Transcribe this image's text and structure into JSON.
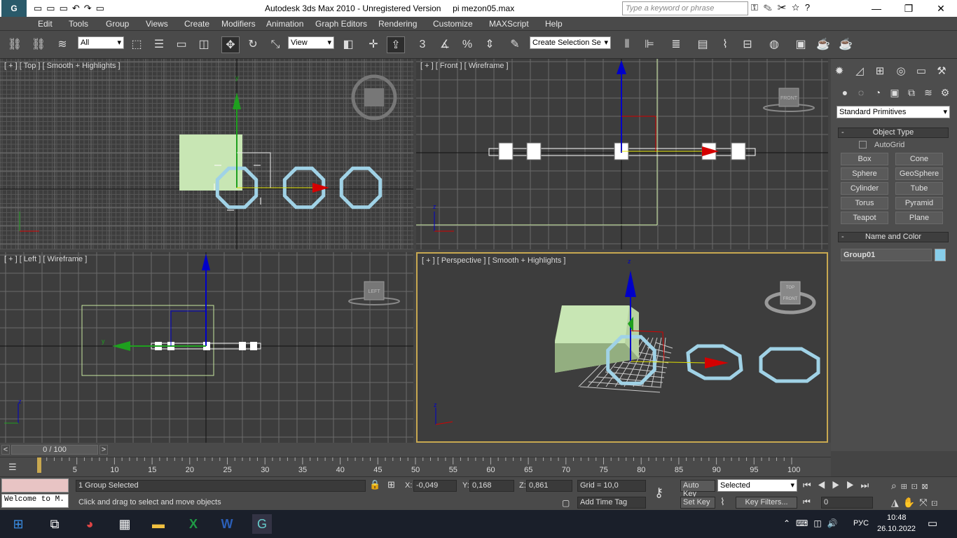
{
  "titlebar": {
    "app": "Autodesk 3ds Max  2010  - Unregistered Version",
    "file": "pi mezon05.max",
    "search_placeholder": "Type a keyword or phrase",
    "min": "—",
    "max": "❐",
    "close": "✕"
  },
  "menu": [
    "Edit",
    "Tools",
    "Group",
    "Views",
    "Create",
    "Modifiers",
    "Animation",
    "Graph Editors",
    "Rendering",
    "Customize",
    "MAXScript",
    "Help"
  ],
  "toolbar": {
    "filter": "All",
    "refcoord": "View",
    "selection_set": "Create Selection Se"
  },
  "viewports": {
    "top": {
      "label": "[ + ] [ Top ] [ Smooth + Highlights ]"
    },
    "front": {
      "label": "[ + ] [ Front ] [ Wireframe ]",
      "cube": "FRONT"
    },
    "left": {
      "label": "[ + ] [ Left ] [ Wireframe ]",
      "cube": "LEFT"
    },
    "persp": {
      "label": "[ + ] [ Perspective ] [ Smooth + Highlights ]",
      "cube_top": "TOP",
      "cube_front": "FRONT"
    }
  },
  "axes": {
    "x": "x",
    "y": "y",
    "z": "z"
  },
  "command_panel": {
    "dropdown": "Standard Primitives",
    "object_type": "Object Type",
    "autogrid": "AutoGrid",
    "buttons": [
      "Box",
      "Cone",
      "Sphere",
      "GeoSphere",
      "Cylinder",
      "Tube",
      "Torus",
      "Pyramid",
      "Teapot",
      "Plane"
    ],
    "name_color": "Name and Color",
    "object_name": "Group01",
    "object_color": "#87ceeb"
  },
  "timeslider": {
    "label": "0 / 100",
    "prev": "<",
    "next": ">"
  },
  "track_ticks": [
    "5",
    "10",
    "15",
    "20",
    "25",
    "30",
    "35",
    "40",
    "45",
    "50",
    "55",
    "60",
    "65",
    "70",
    "75",
    "80",
    "85",
    "90",
    "95",
    "100"
  ],
  "status": {
    "selected": "1 Group Selected",
    "prompt": "Click and drag to select and move objects",
    "script": "Welcome to M.",
    "x_label": "X:",
    "x": "-0,049",
    "y_label": "Y:",
    "y": "0,168",
    "z_label": "Z:",
    "z": "0,861",
    "grid": "Grid = 10,0",
    "add_time_tag": "Add Time Tag",
    "auto_key": "Auto Key",
    "set_key": "Set Key",
    "key_mode": "Selected",
    "key_filters": "Key Filters...",
    "frame": "0"
  },
  "taskbar": {
    "lang": "РУС",
    "time": "10:48",
    "date": "26.10.2022"
  },
  "colors": {
    "box": "#c8e6b4",
    "ring": "#a0d2e6",
    "axis_x": "#d40000",
    "axis_y": "#1ea01e",
    "axis_z": "#0000c8"
  }
}
